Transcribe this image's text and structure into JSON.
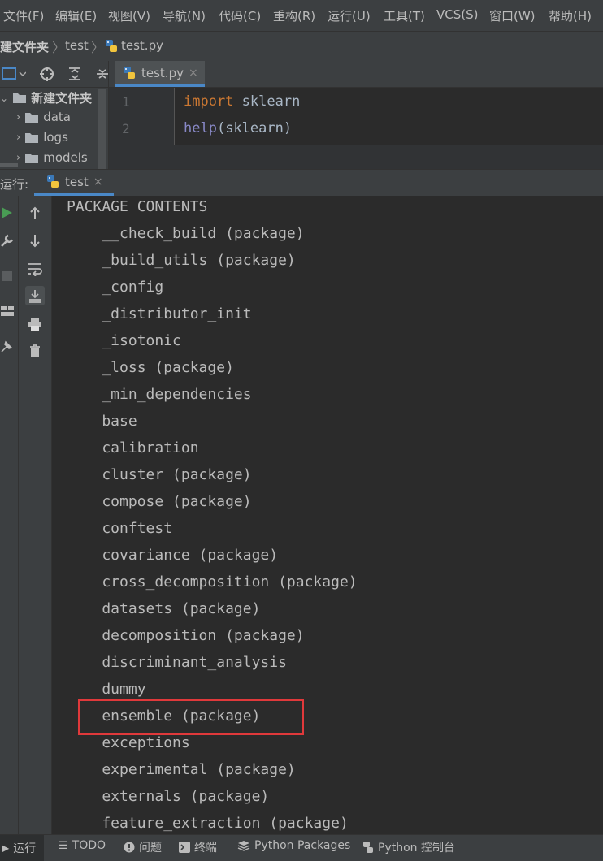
{
  "menu": [
    "文件(F)",
    "编辑(E)",
    "视图(V)",
    "导航(N)",
    "代码(C)",
    "重构(R)",
    "运行(U)",
    "工具(T)",
    "VCS(S)",
    "窗口(W)",
    "帮助(H)"
  ],
  "breadcrumb": [
    "建文件夹",
    "test",
    "test.py"
  ],
  "project": {
    "root": "新建文件夹",
    "items": [
      "data",
      "logs",
      "models"
    ]
  },
  "editor": {
    "tab": "test.py",
    "line_numbers": [
      "1",
      "2"
    ],
    "line1_keyword": "import",
    "line1_rest": " sklearn",
    "line2_func": "help",
    "line2_rest": "(sklearn)"
  },
  "run": {
    "label": "运行:",
    "tab": "test"
  },
  "console_lines": [
    "PACKAGE CONTENTS",
    "    __check_build (package)",
    "    _build_utils (package)",
    "    _config",
    "    _distributor_init",
    "    _isotonic",
    "    _loss (package)",
    "    _min_dependencies",
    "    base",
    "    calibration",
    "    cluster (package)",
    "    compose (package)",
    "    conftest",
    "    covariance (package)",
    "    cross_decomposition (package)",
    "    datasets (package)",
    "    decomposition (package)",
    "    discriminant_analysis",
    "    dummy",
    "    ensemble (package)",
    "    exceptions",
    "    experimental (package)",
    "    externals (package)",
    "    feature_extraction (package)"
  ],
  "bottom_bar": {
    "run": "运行",
    "todo": "TODO",
    "problems": "问题",
    "terminal": "终端",
    "packages": "Python Packages",
    "console": "Python 控制台"
  },
  "colors": {
    "keyword": "#cc7832",
    "builtin": "#8888c6",
    "highlight": "#e0393b",
    "run_green": "#499c54"
  }
}
